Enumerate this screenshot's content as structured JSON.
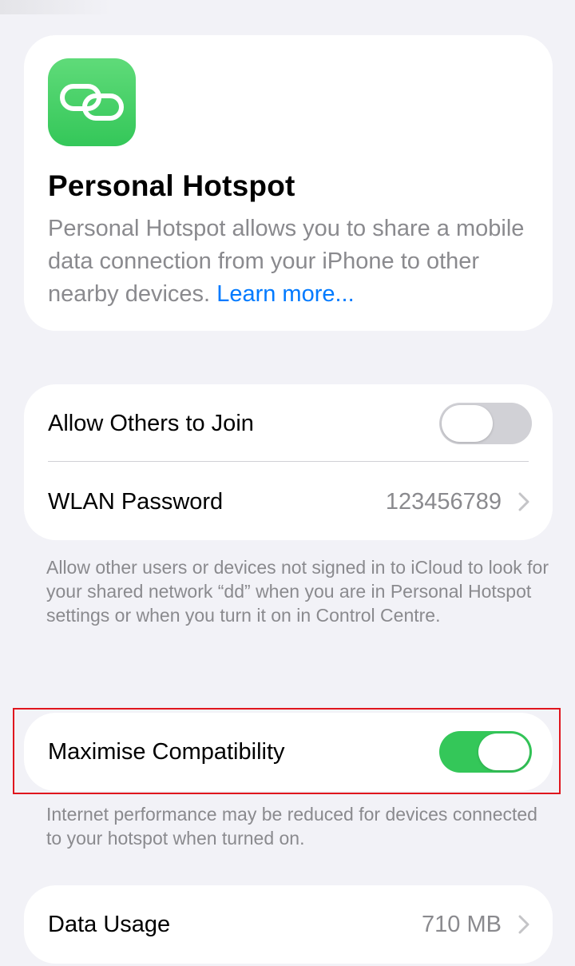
{
  "hero": {
    "icon": "link-chain-icon",
    "title": "Personal Hotspot",
    "description": "Personal Hotspot allows you to share a mobile data connection from your iPhone to other nearby devices.",
    "learn_more": "Learn more..."
  },
  "network_settings": {
    "allow_others": {
      "label": "Allow Others to Join",
      "enabled": false
    },
    "password": {
      "label": "WLAN Password",
      "value": "123456789",
      "icon": "chevron-right-icon"
    },
    "footnote": "Allow other users or devices not signed in to iCloud to look for your shared network “dd” when you are in Personal Hotspot settings or when you turn it on in Control Centre."
  },
  "compatibility": {
    "label": "Maximise Compatibility",
    "enabled": true,
    "footnote": "Internet performance may be reduced for devices connected to your hotspot when turned on."
  },
  "data_usage": {
    "label": "Data Usage",
    "value": "710 MB",
    "icon": "chevron-right-icon"
  },
  "colors": {
    "background": "#f2f2f7",
    "accent": "#007aff",
    "toggle_on": "#34c759",
    "toggle_off": "#d1d1d6",
    "highlight": "#e0161e"
  }
}
